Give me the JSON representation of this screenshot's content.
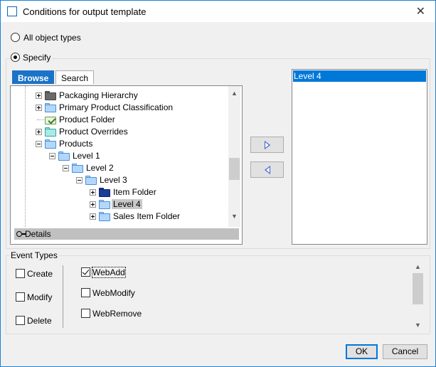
{
  "window": {
    "title": "Conditions for output template"
  },
  "scope": {
    "all_label": "All object types",
    "specify_label": "Specify",
    "selected": "specify"
  },
  "tabs": [
    {
      "label": "Browse",
      "active": true
    },
    {
      "label": "Search",
      "active": false
    }
  ],
  "tree": {
    "items": [
      {
        "label": "Packaging Hierarchy",
        "icon": "folder-gray-icon",
        "expander": "plus",
        "depth": 0
      },
      {
        "label": "Primary Product Classification",
        "icon": "folder-blue-icon",
        "expander": "plus",
        "depth": 0
      },
      {
        "label": "Product Folder",
        "icon": "folder-check-icon",
        "expander": "none",
        "depth": 0
      },
      {
        "label": "Product Overrides",
        "icon": "folder-teal-icon",
        "expander": "plus",
        "depth": 0
      },
      {
        "label": "Products",
        "icon": "folder-blue-icon",
        "expander": "minus",
        "depth": 0
      },
      {
        "label": "Level 1",
        "icon": "folder-blue-icon",
        "expander": "minus",
        "depth": 1
      },
      {
        "label": "Level 2",
        "icon": "folder-blue-icon",
        "expander": "minus",
        "depth": 2
      },
      {
        "label": "Level 3",
        "icon": "folder-blue-icon",
        "expander": "minus",
        "depth": 3
      },
      {
        "label": "Item Folder",
        "icon": "folder-navy-icon",
        "expander": "plus",
        "depth": 4
      },
      {
        "label": "Level 4",
        "icon": "folder-blue-icon",
        "expander": "plus",
        "depth": 4,
        "selected": true
      },
      {
        "label": "Sales Item Folder",
        "icon": "folder-blue-icon",
        "expander": "plus",
        "depth": 4
      }
    ],
    "details_label": "Details"
  },
  "selected_list": {
    "items": [
      "Level 4"
    ]
  },
  "event_types": {
    "legend": "Event Types",
    "left": [
      {
        "label": "Create",
        "checked": false
      },
      {
        "label": "Modify",
        "checked": false
      },
      {
        "label": "Delete",
        "checked": false
      }
    ],
    "right": [
      {
        "label": "WebAdd",
        "checked": true
      },
      {
        "label": "WebModify",
        "checked": false
      },
      {
        "label": "WebRemove",
        "checked": false
      }
    ]
  },
  "buttons": {
    "ok": "OK",
    "cancel": "Cancel"
  }
}
